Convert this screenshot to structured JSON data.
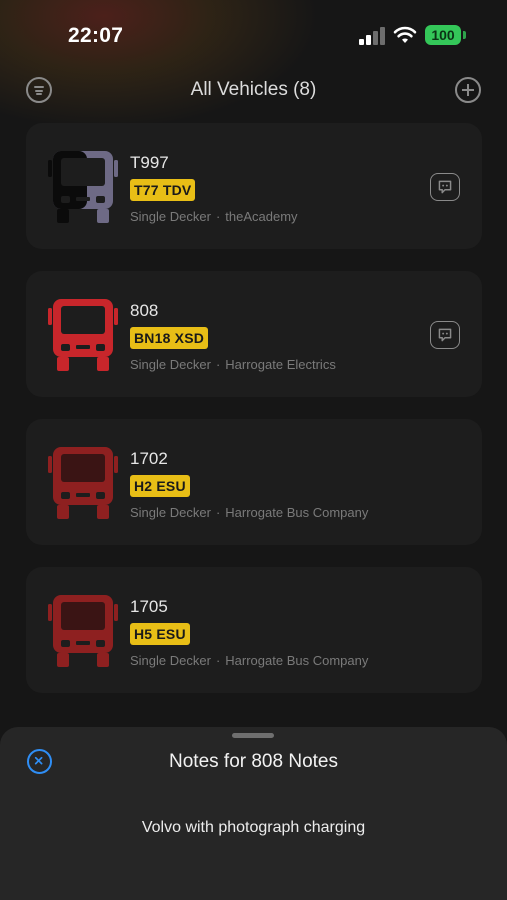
{
  "status_bar": {
    "time": "22:07",
    "battery": "100"
  },
  "nav": {
    "title": "All Vehicles (8)"
  },
  "vehicles": [
    {
      "fleet": "T997",
      "plate": "T77 TDV",
      "type": "Single Decker",
      "operator": "theAcademy",
      "has_note": true
    },
    {
      "fleet": "808",
      "plate": "BN18 XSD",
      "type": "Single Decker",
      "operator": "Harrogate Electrics",
      "has_note": true
    },
    {
      "fleet": "1702",
      "plate": "H2 ESU",
      "type": "Single Decker",
      "operator": "Harrogate Bus Company",
      "has_note": false
    },
    {
      "fleet": "1705",
      "plate": "H5 ESU",
      "type": "Single Decker",
      "operator": "Harrogate Bus Company",
      "has_note": false
    }
  ],
  "sheet": {
    "title": "Notes for 808 Notes",
    "body": "Volvo with photograph charging"
  },
  "colors": {
    "background": "#161616",
    "card": "#1d1d1d",
    "plate": "#e8be16",
    "accent": "#2f8ef5",
    "battery": "#34c759",
    "bus_red": "#c8262b",
    "bus_dark_red": "#8e2020",
    "bus_grey": "#6e6a85"
  },
  "icons": {
    "filter": "filter-circle-icon",
    "add": "plus-circle-icon",
    "note": "speech-bubble-icon",
    "close": "close-circle-icon",
    "bus": "bus-front-icon"
  }
}
